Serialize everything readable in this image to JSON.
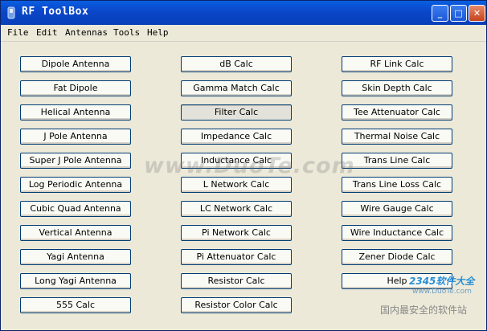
{
  "window": {
    "title": "RF ToolBox",
    "controls": {
      "minimize": "_",
      "maximize": "□",
      "close": "✕"
    }
  },
  "menu": [
    "File",
    "Edit",
    "Antennas",
    "Tools",
    "Help"
  ],
  "buttons": {
    "col1": [
      "Dipole Antenna",
      "Fat Dipole",
      "Helical Antenna",
      "J Pole Antenna",
      "Super J Pole Antenna",
      "Log Periodic Antenna",
      "Cubic Quad Antenna",
      "Vertical Antenna",
      "Yagi Antenna",
      "Long Yagi Antenna",
      "555 Calc"
    ],
    "col2": [
      "dB Calc",
      "Gamma Match Calc",
      "Filter Calc",
      "Impedance Calc",
      "Inductance Calc",
      "L Network Calc",
      "LC Network Calc",
      "Pi Network Calc",
      "Pi Attenuator Calc",
      "Resistor Calc",
      "Resistor Color Calc"
    ],
    "col3": [
      "RF Link Calc",
      "Skin Depth Calc",
      "Tee Attenuator Calc",
      "Thermal Noise Calc",
      "Trans Line Calc",
      "Trans Line Loss Calc",
      "Wire Gauge Calc",
      "Wire Inductance Calc",
      "Zener Diode Calc",
      "Help"
    ]
  },
  "watermark": {
    "text": "www.DuoTe.com",
    "logo": "2345软件大全",
    "url": "www.DuoTe.com",
    "cn": "国内最安全的软件站"
  },
  "colors": {
    "titlebar": "#0b46c9",
    "face": "#ece9d8",
    "button_border": "#003c74"
  }
}
